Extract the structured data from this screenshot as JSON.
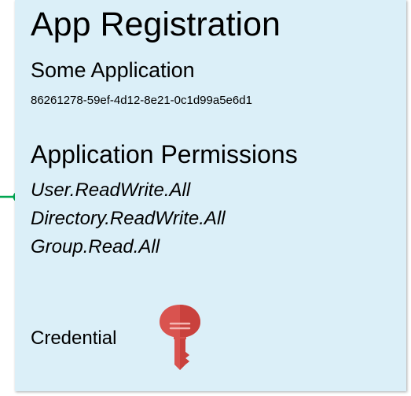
{
  "card": {
    "title": "App Registration",
    "app_name": "Some Application",
    "app_id": "86261278-59ef-4d12-8e21-0c1d99a5e6d1",
    "permissions_title": "Application Permissions",
    "permissions": [
      "User.ReadWrite.All",
      "Directory.ReadWrite.All",
      "Group.Read.All"
    ],
    "credential_label": "Credential",
    "credential_icon": "key-icon"
  },
  "colors": {
    "card_background": "#dbeff8",
    "connector": "#00a651",
    "key": "#d9534f"
  }
}
